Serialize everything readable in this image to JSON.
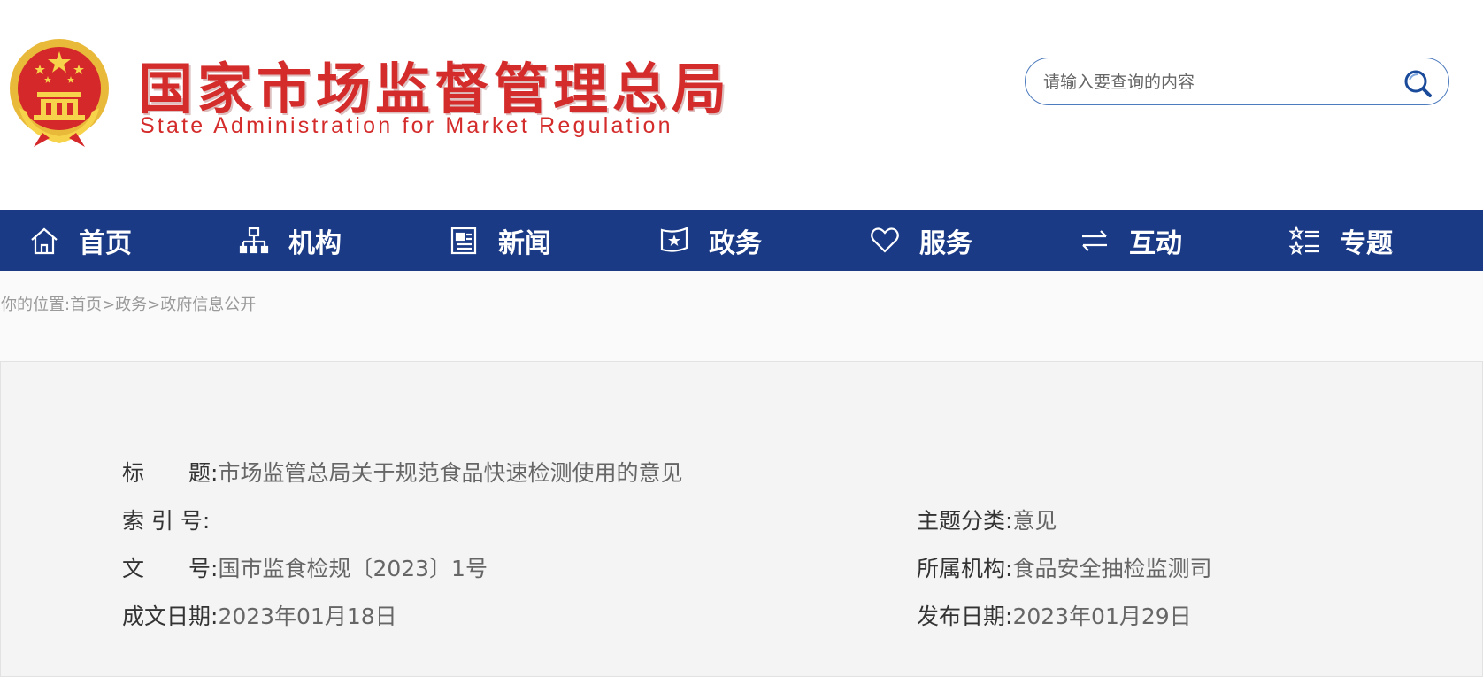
{
  "header": {
    "logo_cn": "国家市场监督管理总局",
    "logo_en": "State Administration for Market Regulation"
  },
  "search": {
    "placeholder": "请输入要查询的内容"
  },
  "nav": {
    "items": [
      {
        "label": "首页",
        "icon": "home-icon"
      },
      {
        "label": "机构",
        "icon": "org-chart-icon"
      },
      {
        "label": "新闻",
        "icon": "news-icon"
      },
      {
        "label": "政务",
        "icon": "government-shield-icon"
      },
      {
        "label": "服务",
        "icon": "heart-icon"
      },
      {
        "label": "互动",
        "icon": "exchange-arrows-icon"
      },
      {
        "label": "专题",
        "icon": "star-list-icon"
      }
    ]
  },
  "breadcrumb": {
    "prefix": "你的位置:",
    "items": [
      "首页",
      "政务",
      "政府信息公开"
    ],
    "separator": ">"
  },
  "info": {
    "title": {
      "label": "标　　题:",
      "value": "市场监管总局关于规范食品快速检测使用的意见"
    },
    "index_no": {
      "label": "索 引 号:",
      "value": ""
    },
    "topic": {
      "label": "主题分类:",
      "value": "意见"
    },
    "doc_no": {
      "label": "文　　号:",
      "value": "国市监食检规〔2023〕1号"
    },
    "agency": {
      "label": "所属机构:",
      "value": "食品安全抽检监测司"
    },
    "written_date": {
      "label": "成文日期:",
      "value": "2023年01月18日"
    },
    "publish_date": {
      "label": "发布日期:",
      "value": "2023年01月29日"
    }
  },
  "colors": {
    "nav_bg": "#1a3a86",
    "logo_red": "#d42b2b",
    "search_border": "#4d7bbd"
  }
}
